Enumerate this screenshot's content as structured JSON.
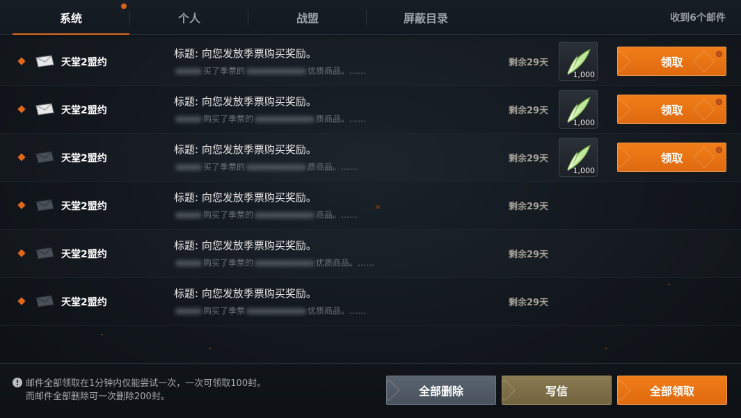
{
  "tabs": [
    {
      "label": "系统",
      "active": true,
      "has_badge": true
    },
    {
      "label": "个人",
      "active": false
    },
    {
      "label": "战盟",
      "active": false
    },
    {
      "label": "屏蔽目录",
      "active": false
    }
  ],
  "mail_count": "收到6个邮件",
  "mails": [
    {
      "read": false,
      "sender": "天堂2盟约",
      "subject": "标题: 向您发放季票购买奖励。",
      "preview_a": "买了季票的",
      "preview_b": "优质商品。……",
      "expire": "剩余29天",
      "has_reward": true,
      "reward_qty": "1,000",
      "claim_label": "领取"
    },
    {
      "read": false,
      "sender": "天堂2盟约",
      "subject": "标题: 向您发放季票购买奖励。",
      "preview_a": "购买了季票的",
      "preview_b": "质商品。……",
      "expire": "剩余29天",
      "has_reward": true,
      "reward_qty": "1,000",
      "claim_label": "领取"
    },
    {
      "read": true,
      "sender": "天堂2盟约",
      "subject": "标题: 向您发放季票购买奖励。",
      "preview_a": "买了季票的",
      "preview_b": "质商品。……",
      "expire": "剩余29天",
      "has_reward": true,
      "reward_qty": "1,000",
      "claim_label": "领取"
    },
    {
      "read": true,
      "sender": "天堂2盟约",
      "subject": "标题: 向您发放季票购买奖励。",
      "preview_a": "购买了季票的",
      "preview_b": "商品。……",
      "expire": "剩余29天",
      "has_reward": false
    },
    {
      "read": true,
      "sender": "天堂2盟约",
      "subject": "标题: 向您发放季票购买奖励。",
      "preview_a": "购买了季票的",
      "preview_b": "优质商品。……",
      "expire": "剩余29天",
      "has_reward": false
    },
    {
      "read": true,
      "sender": "天堂2盟约",
      "subject": "标题: 向您发放季票购买奖励。",
      "preview_a": "购买了季票",
      "preview_b": "优质商品。……",
      "expire": "剩余29天",
      "has_reward": false
    }
  ],
  "footer": {
    "notice_line1": "邮件全部领取在1分钟内仅能尝试一次，一次可领取100封。",
    "notice_line2": "而邮件全部删除可一次删除200封。",
    "delete_all_label": "全部删除",
    "write_label": "写信",
    "claim_all_label": "全部领取"
  },
  "colors": {
    "accent": "#e06a1e",
    "button_orange": "#f07d18",
    "bg": "#12171d"
  },
  "icons": {
    "bullet": "diamond-bullet-icon",
    "mail": "envelope-icon",
    "reward": "feather-icon",
    "notice": "info-icon"
  }
}
